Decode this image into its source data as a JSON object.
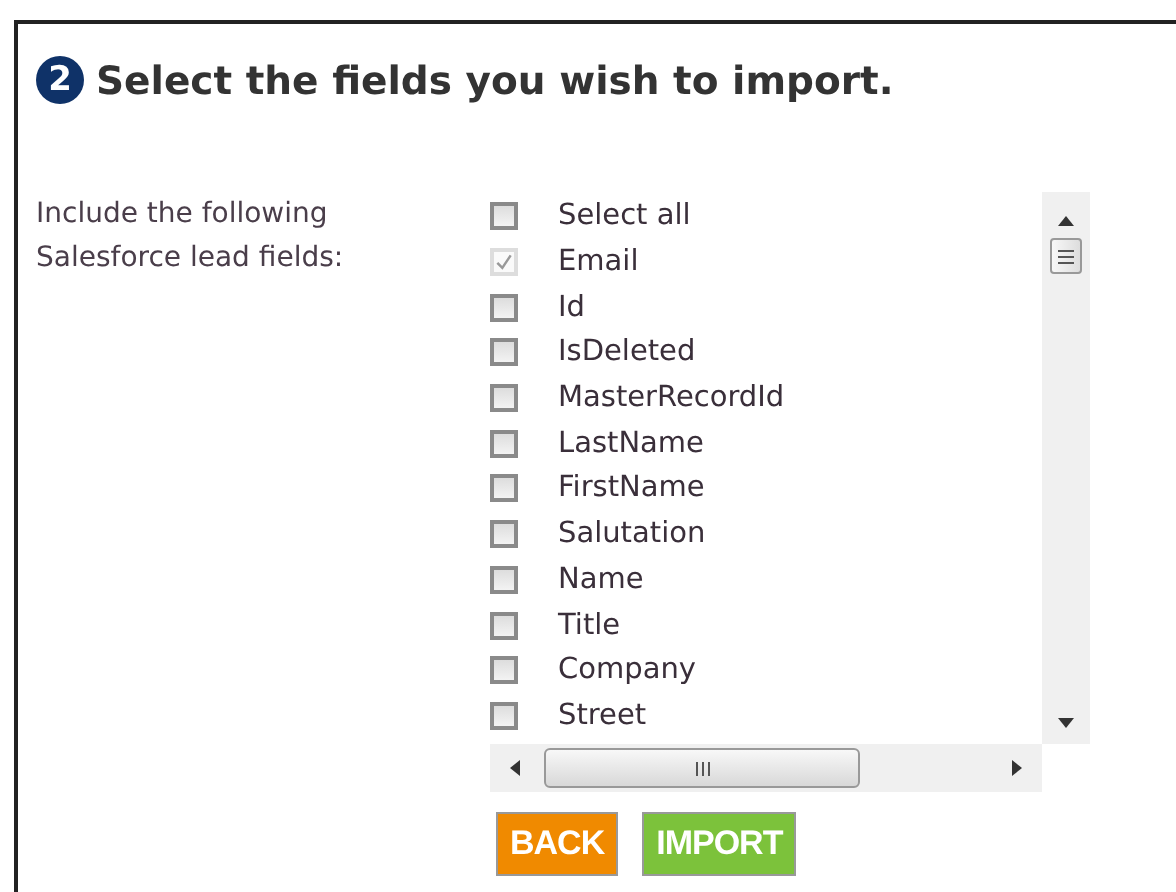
{
  "step": {
    "number": "2",
    "title": "Select the fields you wish to import."
  },
  "prompt": "Include the following Salesforce lead fields:",
  "fields": [
    {
      "label": "Select all",
      "checked": false,
      "disabled": false
    },
    {
      "label": "Email",
      "checked": true,
      "disabled": true
    },
    {
      "label": "Id",
      "checked": false,
      "disabled": false
    },
    {
      "label": "IsDeleted",
      "checked": false,
      "disabled": false
    },
    {
      "label": "MasterRecordId",
      "checked": false,
      "disabled": false
    },
    {
      "label": "LastName",
      "checked": false,
      "disabled": false
    },
    {
      "label": "FirstName",
      "checked": false,
      "disabled": false
    },
    {
      "label": "Salutation",
      "checked": false,
      "disabled": false
    },
    {
      "label": "Name",
      "checked": false,
      "disabled": false
    },
    {
      "label": "Title",
      "checked": false,
      "disabled": false
    },
    {
      "label": "Company",
      "checked": false,
      "disabled": false
    },
    {
      "label": "Street",
      "checked": false,
      "disabled": false
    }
  ],
  "buttons": [
    {
      "label": "BACK",
      "kind": "back"
    },
    {
      "label": "IMPORT",
      "kind": "import"
    }
  ]
}
